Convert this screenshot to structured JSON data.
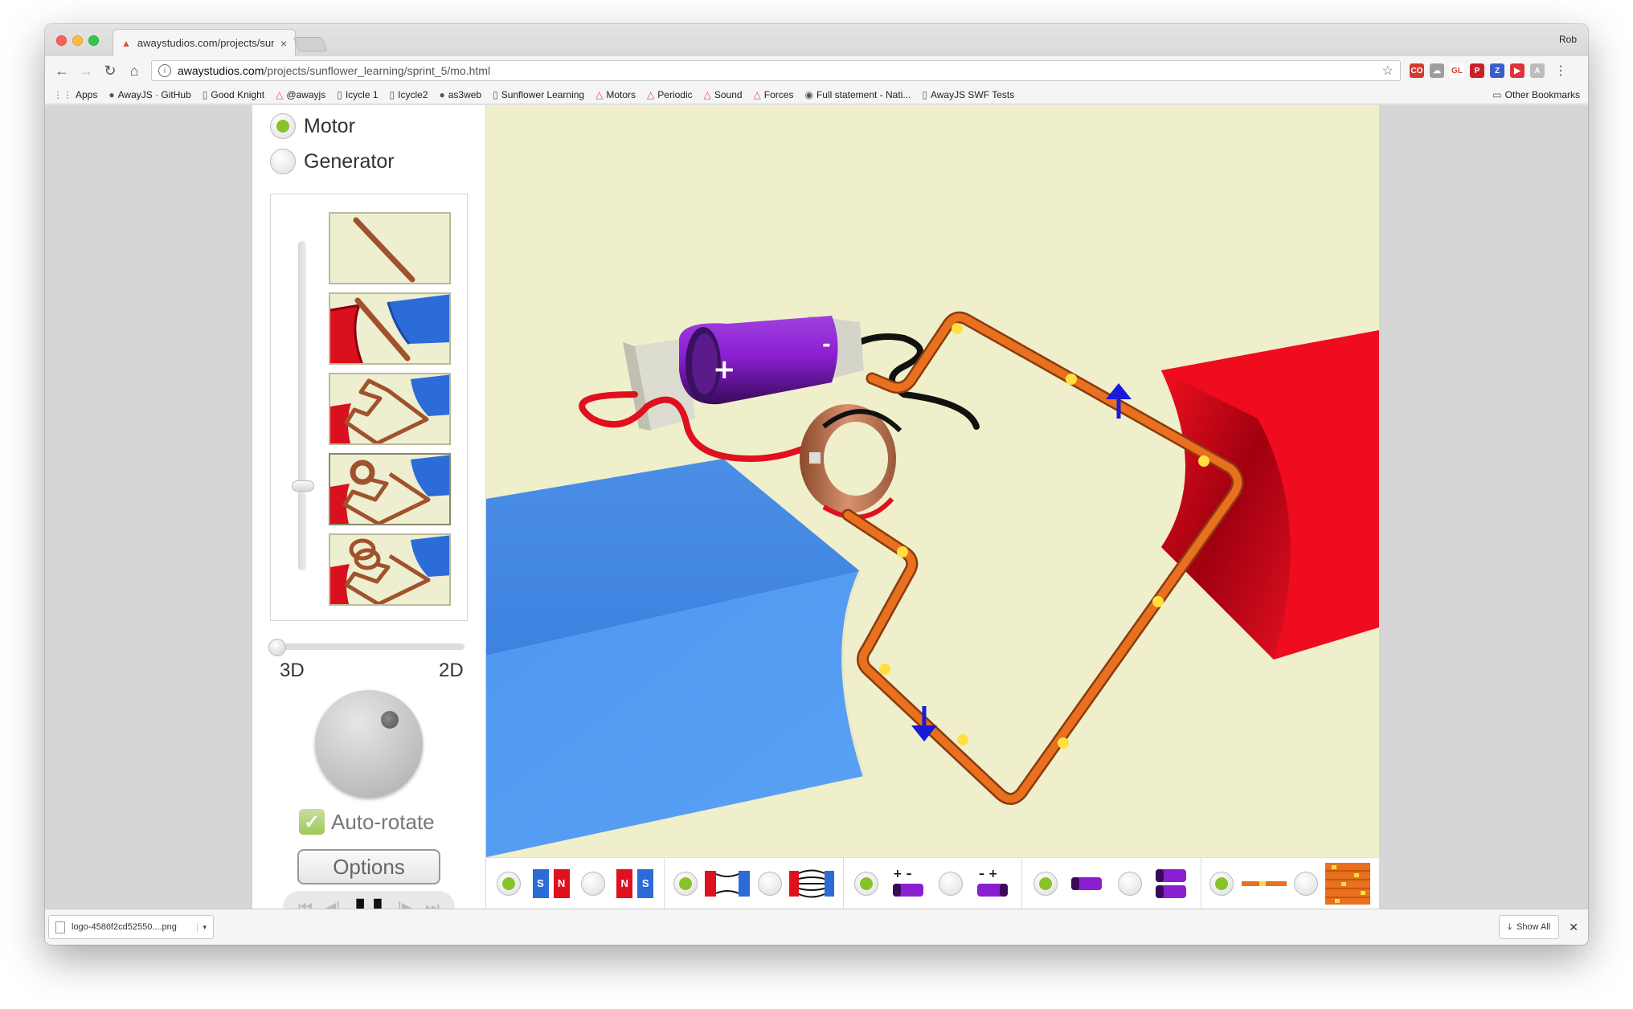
{
  "browser": {
    "tab_title": "awaystudios.com/projects/sun",
    "profile_name": "Rob",
    "url_host": "awaystudios.com",
    "url_path": "/projects/sunflower_learning/sprint_5/mo.html",
    "bookmarks": [
      {
        "label": "Apps",
        "icon": "apps-grid-icon"
      },
      {
        "label": "AwayJS · GitHub",
        "icon": "github-icon"
      },
      {
        "label": "Good Knight",
        "icon": "page-icon"
      },
      {
        "label": "@awayjs",
        "icon": "triangle-icon"
      },
      {
        "label": "Icycle 1",
        "icon": "page-icon"
      },
      {
        "label": "Icycle2",
        "icon": "page-icon"
      },
      {
        "label": "as3web",
        "icon": "github-icon"
      },
      {
        "label": "Sunflower Learning",
        "icon": "page-icon"
      },
      {
        "label": "Motors",
        "icon": "triangle-icon"
      },
      {
        "label": "Periodic",
        "icon": "triangle-icon"
      },
      {
        "label": "Sound",
        "icon": "triangle-icon"
      },
      {
        "label": "Forces",
        "icon": "triangle-icon"
      },
      {
        "label": "Full statement - Nati...",
        "icon": "globe-icon"
      },
      {
        "label": "AwayJS SWF Tests",
        "icon": "page-icon"
      }
    ],
    "other_bookmarks": "Other Bookmarks",
    "extensions": [
      {
        "label": "CO",
        "color": "#d43a2f"
      },
      {
        "label": "☁",
        "color": "#9e9e9e"
      },
      {
        "label": "GL",
        "color": "#ffffff"
      },
      {
        "label": "P",
        "color": "#cb2027"
      },
      {
        "label": "Z",
        "color": "#3a5fcd"
      },
      {
        "label": "▶",
        "color": "#e0333a"
      },
      {
        "label": "A",
        "color": "#bdbdbd"
      }
    ]
  },
  "app": {
    "mode_options": [
      {
        "label": "Motor",
        "selected": true
      },
      {
        "label": "Generator",
        "selected": false
      }
    ],
    "levels": [
      {
        "name": "wire",
        "selected": false
      },
      {
        "name": "wire-between-magnets",
        "selected": false
      },
      {
        "name": "square-loop-between-magnets",
        "selected": false
      },
      {
        "name": "loop-with-split-ring",
        "selected": true
      },
      {
        "name": "coil-with-split-ring",
        "selected": false
      }
    ],
    "view_slider": {
      "left_label": "3D",
      "right_label": "2D",
      "value": 0
    },
    "autorotate": {
      "label": "Auto-rotate",
      "checked": true
    },
    "options_label": "Options",
    "transport": {
      "playing": true
    },
    "option_groups": [
      {
        "name": "magnet-polarity",
        "selected_index": 0,
        "choices": [
          "S N",
          "N S"
        ]
      },
      {
        "name": "field-lines",
        "selected_index": 0,
        "choices": [
          "magnets",
          "field-lines"
        ]
      },
      {
        "name": "battery-direction",
        "selected_index": 0,
        "choices": [
          "+ -",
          "- +"
        ]
      },
      {
        "name": "battery-count",
        "selected_index": 0,
        "choices": [
          "one",
          "two"
        ]
      },
      {
        "name": "current-display",
        "selected_index": 0,
        "choices": [
          "wire",
          "electrons"
        ]
      }
    ],
    "colors": {
      "accent_green": "#86c32a",
      "magnet_north": "#e0101f",
      "magnet_south": "#2b6cd8",
      "wire": "#e46a1e",
      "battery": "#8a1fd1",
      "viewport_bg": "#efefcb"
    }
  },
  "downloads": {
    "file_name": "logo-4586f2cd52550....png",
    "show_all_label": "Show All"
  }
}
